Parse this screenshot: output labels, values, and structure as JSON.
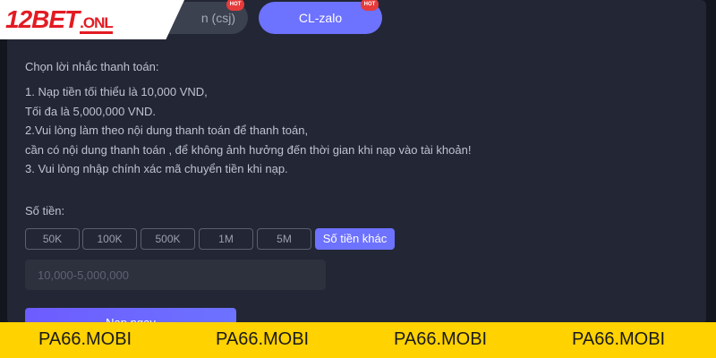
{
  "logo": {
    "main": "12BET",
    "suffix": ".ONL"
  },
  "tabs": [
    {
      "label": "n  (csj)",
      "badge": "HOT"
    },
    {
      "label": "CL-zalo",
      "badge": "HOT"
    }
  ],
  "instructions": {
    "title": "Chọn lời nhắc thanh toán:",
    "lines": [
      "1. Nạp tiền tối thiểu là 10,000 VND,",
      "Tối đa là 5,000,000 VND.",
      "2.Vui lòng làm theo nội dung thanh toán để thanh toán,",
      "cần có nội dung thanh toán , để không ảnh hưởng đến thời gian khi nạp vào tài khoản!",
      "3. Vui lòng nhập chính xác mã chuyển tiền khi nạp."
    ]
  },
  "amount": {
    "label": "Số tiền:",
    "options": [
      "50K",
      "100K",
      "500K",
      "1M",
      "5M",
      "Số tiền khác"
    ],
    "selected": "Số tiền khác",
    "input_placeholder": "10,000-5,000,000"
  },
  "submit_label": "Nạp ngay",
  "footer": [
    "PA66.MOBI",
    "PA66.MOBI",
    "PA66.MOBI",
    "PA66.MOBI"
  ],
  "colors": {
    "accent": "#6d72ff",
    "badge": "#e53b3b",
    "footer": "#ffd200",
    "brand": "#e31b23"
  }
}
